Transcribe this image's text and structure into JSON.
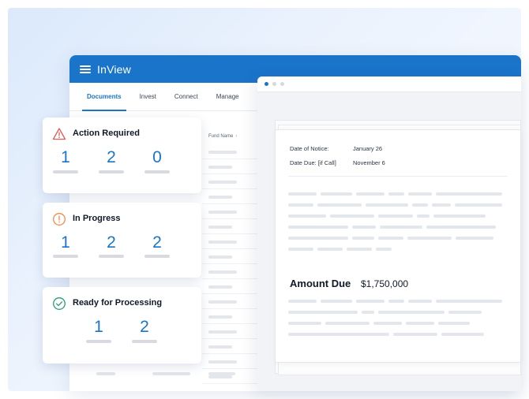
{
  "app": {
    "title": "InView",
    "tabs": [
      "Documents",
      "Invest",
      "Connect",
      "Manage"
    ],
    "active_tab": "Documents",
    "table": {
      "column_header": "Fund Name"
    }
  },
  "cards": [
    {
      "title": "Action Required",
      "icon": "warning-triangle-icon",
      "color": "#e05a5a",
      "counts": [
        "1",
        "2",
        "0"
      ]
    },
    {
      "title": "In Progress",
      "icon": "info-circle-icon",
      "color": "#f08a4b",
      "counts": [
        "1",
        "2",
        "2"
      ]
    },
    {
      "title": "Ready for Processing",
      "icon": "check-circle-icon",
      "color": "#2c9a7a",
      "counts": [
        "1",
        "2"
      ]
    }
  ],
  "document": {
    "notice_label": "Date of Notice:",
    "notice_value": "January 26",
    "due_label": "Date Due: [if Call]",
    "due_value": "November 6",
    "amount_label": "Amount Due",
    "amount_value": "$1,750,000"
  },
  "colors": {
    "brand": "#1a74c9",
    "accent_number": "#1a74c9"
  }
}
